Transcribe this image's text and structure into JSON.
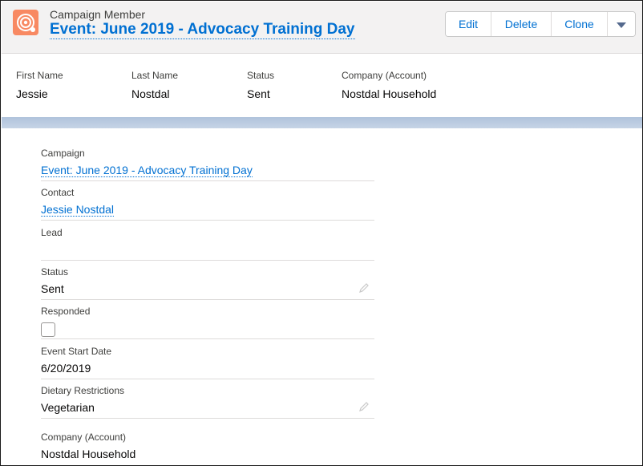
{
  "header": {
    "object_type": "Campaign Member",
    "record_title": "Event: June 2019 - Advocacy Training Day",
    "icon": "campaign-member-icon",
    "accent_color": "#f88962"
  },
  "actions": {
    "edit": "Edit",
    "delete": "Delete",
    "clone": "Clone",
    "more_icon": "chevron-down-icon"
  },
  "highlights": [
    {
      "label": "First Name",
      "value": "Jessie"
    },
    {
      "label": "Last Name",
      "value": "Nostdal"
    },
    {
      "label": "Status",
      "value": "Sent"
    },
    {
      "label": "Company (Account)",
      "value": "Nostdal Household"
    }
  ],
  "details": {
    "campaign": {
      "label": "Campaign",
      "value": "Event: June 2019 - Advocacy Training Day"
    },
    "contact": {
      "label": "Contact",
      "value": "Jessie Nostdal"
    },
    "lead": {
      "label": "Lead",
      "value": ""
    },
    "status": {
      "label": "Status",
      "value": "Sent"
    },
    "responded": {
      "label": "Responded",
      "checked": false
    },
    "event_start_date": {
      "label": "Event Start Date",
      "value": "6/20/2019"
    },
    "dietary_restrictions": {
      "label": "Dietary Restrictions",
      "value": "Vegetarian"
    },
    "company": {
      "label": "Company (Account)",
      "value": "Nostdal Household"
    }
  }
}
